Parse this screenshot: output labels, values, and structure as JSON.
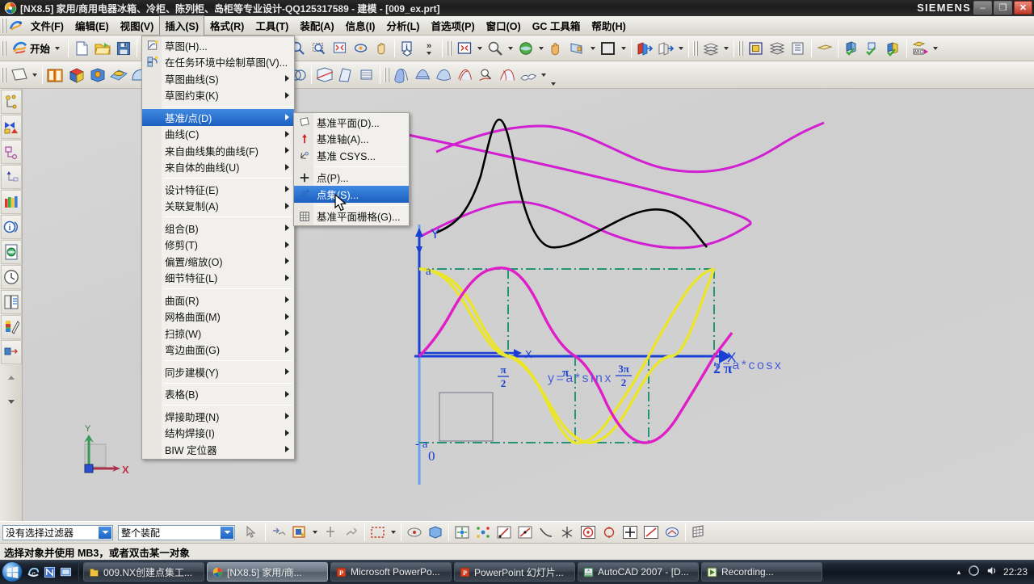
{
  "window": {
    "title": "[NX8.5] 家用/商用电器冰箱、冷柜、陈列柜、岛柜等专业设计-QQ125317589 - 建模 - [009_ex.prt]",
    "brand": "SIEMENS",
    "minimize": "–",
    "restore": "❐",
    "close": "✕",
    "doc_minimize": "–",
    "doc_restore": "❐",
    "doc_close": "✕"
  },
  "menubar": {
    "items": [
      {
        "label": "文件(F)",
        "active": false
      },
      {
        "label": "编辑(E)",
        "active": false
      },
      {
        "label": "视图(V)",
        "active": false
      },
      {
        "label": "插入(S)",
        "active": true
      },
      {
        "label": "格式(R)",
        "active": false
      },
      {
        "label": "工具(T)",
        "active": false
      },
      {
        "label": "装配(A)",
        "active": false
      },
      {
        "label": "信息(I)",
        "active": false
      },
      {
        "label": "分析(L)",
        "active": false
      },
      {
        "label": "首选项(P)",
        "active": false
      },
      {
        "label": "窗口(O)",
        "active": false
      },
      {
        "label": "GC 工具箱",
        "active": false
      },
      {
        "label": "帮助(H)",
        "active": false
      }
    ]
  },
  "toolbar": {
    "start_label": "开始"
  },
  "insert_menu": {
    "items": [
      {
        "label": "草图(H)...",
        "icon": "sketch-icon",
        "arrow": false,
        "selected": false
      },
      {
        "label": "在任务环境中绘制草图(V)...",
        "icon": "task-sketch-icon",
        "arrow": false,
        "selected": false
      },
      {
        "label": "草图曲线(S)",
        "icon": "",
        "arrow": true,
        "selected": false
      },
      {
        "label": "草图约束(K)",
        "icon": "",
        "arrow": true,
        "selected": false
      },
      {
        "sep": true
      },
      {
        "label": "基准/点(D)",
        "icon": "",
        "arrow": true,
        "selected": true
      },
      {
        "label": "曲线(C)",
        "icon": "",
        "arrow": true,
        "selected": false
      },
      {
        "label": "来自曲线集的曲线(F)",
        "icon": "",
        "arrow": true,
        "selected": false
      },
      {
        "label": "来自体的曲线(U)",
        "icon": "",
        "arrow": true,
        "selected": false
      },
      {
        "sep": true
      },
      {
        "label": "设计特征(E)",
        "icon": "",
        "arrow": true,
        "selected": false
      },
      {
        "label": "关联复制(A)",
        "icon": "",
        "arrow": true,
        "selected": false
      },
      {
        "sep": true
      },
      {
        "label": "组合(B)",
        "icon": "",
        "arrow": true,
        "selected": false
      },
      {
        "label": "修剪(T)",
        "icon": "",
        "arrow": true,
        "selected": false
      },
      {
        "label": "偏置/缩放(O)",
        "icon": "",
        "arrow": true,
        "selected": false
      },
      {
        "label": "细节特征(L)",
        "icon": "",
        "arrow": true,
        "selected": false
      },
      {
        "sep": true
      },
      {
        "label": "曲面(R)",
        "icon": "",
        "arrow": true,
        "selected": false
      },
      {
        "label": "网格曲面(M)",
        "icon": "",
        "arrow": true,
        "selected": false
      },
      {
        "label": "扫掠(W)",
        "icon": "",
        "arrow": true,
        "selected": false
      },
      {
        "label": "弯边曲面(G)",
        "icon": "",
        "arrow": true,
        "selected": false
      },
      {
        "sep": true
      },
      {
        "label": "同步建模(Y)",
        "icon": "",
        "arrow": true,
        "selected": false
      },
      {
        "sep": true
      },
      {
        "label": "表格(B)",
        "icon": "",
        "arrow": true,
        "selected": false
      },
      {
        "sep": true
      },
      {
        "label": "焊接助理(N)",
        "icon": "",
        "arrow": true,
        "selected": false
      },
      {
        "label": "结构焊接(I)",
        "icon": "",
        "arrow": true,
        "selected": false
      },
      {
        "label": "BIW 定位器",
        "icon": "",
        "arrow": true,
        "selected": false
      }
    ]
  },
  "datum_menu": {
    "items": [
      {
        "label": "基准平面(D)...",
        "icon": "datum-plane-icon",
        "selected": false
      },
      {
        "label": "基准轴(A)...",
        "icon": "datum-axis-icon",
        "selected": false
      },
      {
        "label": "基准 CSYS...",
        "icon": "datum-csys-icon",
        "selected": false
      },
      {
        "sep": true
      },
      {
        "label": "点(P)...",
        "icon": "point-icon",
        "selected": false
      },
      {
        "label": "点集(S)...",
        "icon": "point-set-icon",
        "selected": true
      },
      {
        "sep": true
      },
      {
        "label": "基准平面栅格(G)...",
        "icon": "datum-grid-icon",
        "selected": false
      }
    ]
  },
  "selection_bar": {
    "filter_value": "没有选择过滤器",
    "scope_value": "整个装配"
  },
  "status_bar": {
    "message": "选择对象并使用 MB3，或者双击某一对象"
  },
  "graphics": {
    "labels": {
      "y_axis": "Y",
      "x_axis": "X",
      "x_small": "X",
      "origin": "0",
      "a_pos": "a",
      "a_neg": "- a",
      "tick_pi_half_num": "π",
      "tick_pi_half_den": "2",
      "tick_pi": "π",
      "tick_3pi_half_num": "3π",
      "tick_3pi_half_den": "2",
      "tick_2pi": "2 π",
      "curve_sin": "y=a*sinx",
      "curve_cos": "y=a*cosx"
    },
    "triad": {
      "x": "X",
      "y": "Y"
    }
  },
  "chart_data": {
    "type": "line",
    "title": "",
    "xlabel": "X",
    "ylabel": "Y",
    "xlim": [
      0,
      6.2832
    ],
    "ylim": [
      -1,
      1
    ],
    "xticks": [
      "0",
      "π/2",
      "π",
      "3π/2",
      "2π"
    ],
    "yticks": [
      "-a",
      "0",
      "a"
    ],
    "grid": false,
    "series": [
      {
        "name": "y=a*sinx",
        "color": "#e01ec8",
        "points_desc": "sine wave, amplitude a, zero at 0, π, 2π; max a at π/2; min -a at 3π/2"
      },
      {
        "name": "y=a*cosx",
        "color": "#ebe52b",
        "points_desc": "cosine wave, amplitude a, max a at 0 and 2π; zero at π/2 and 3π/2; min -a at π"
      }
    ],
    "annotations": [
      {
        "text": "y=a*sinx",
        "x": 2.2,
        "y": 0.72
      },
      {
        "text": "y=a*cosx",
        "x": 5.6,
        "y": 0.88
      }
    ]
  },
  "taskbar": {
    "items": [
      {
        "label": "009.NX创建点集工...",
        "icon": "folder-icon",
        "active": false
      },
      {
        "label": "[NX8.5] 家用/商...",
        "icon": "nx-icon",
        "active": true
      },
      {
        "label": "Microsoft PowerPo...",
        "icon": "powerpoint-icon",
        "active": false
      },
      {
        "label": "PowerPoint 幻灯片...",
        "icon": "powerpoint-icon",
        "active": false
      },
      {
        "label": "AutoCAD 2007 - [D...",
        "icon": "autocad-icon",
        "active": false
      },
      {
        "label": "Recording...",
        "icon": "recording-icon",
        "active": false
      }
    ],
    "clock": "22:23",
    "show_hidden": "▲"
  },
  "colors": {
    "accent": "#1c5fc0",
    "selection": "#3f8ae0",
    "sin_curve": "#e01ec8",
    "cos_curve": "#ebe52b",
    "axis": "#1a3fd4",
    "dashdot": "#0b8a6a",
    "freecurve_magenta": "#d11fd1",
    "freecurve_black": "#000000",
    "titlebar": "#1b1b1b",
    "toolbar": "#e7e5df"
  }
}
